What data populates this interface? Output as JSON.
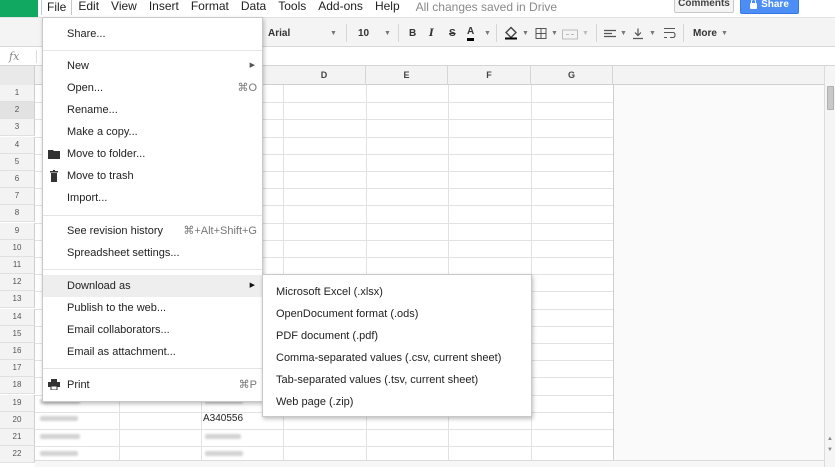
{
  "menubar": {
    "items": [
      "File",
      "Edit",
      "View",
      "Insert",
      "Format",
      "Data",
      "Tools",
      "Add-ons",
      "Help"
    ],
    "status": "All changes saved in Drive",
    "comments_label": "Comments",
    "share_label": "Share",
    "brand_color": "#11a861",
    "share_color": "#4c8ef6"
  },
  "toolbar": {
    "font_family": "Arial",
    "font_size": "10",
    "bold": "B",
    "italic": "I",
    "strike": "S",
    "text_color": "A",
    "more_label": "More"
  },
  "formula_bar": {
    "fx": "fx"
  },
  "columns": [
    "D",
    "E",
    "F",
    "G"
  ],
  "rows": [
    "1",
    "2",
    "3",
    "4",
    "5",
    "6",
    "7",
    "8",
    "9",
    "10",
    "11",
    "12",
    "13",
    "14",
    "15",
    "16",
    "17",
    "18",
    "19",
    "20",
    "21",
    "22"
  ],
  "selected_row": "2",
  "cells": {
    "visible_value": "A340556"
  },
  "file_menu": {
    "share": "Share...",
    "new": "New",
    "open": "Open...",
    "open_shortcut": "⌘O",
    "rename": "Rename...",
    "make_copy": "Make a copy...",
    "move_to_folder": "Move to folder...",
    "move_to_trash": "Move to trash",
    "import": "Import...",
    "revision_history": "See revision history",
    "revision_shortcut": "⌘+Alt+Shift+G",
    "spreadsheet_settings": "Spreadsheet settings...",
    "download_as": "Download as",
    "publish": "Publish to the web...",
    "email_collaborators": "Email collaborators...",
    "email_attachment": "Email as attachment...",
    "print": "Print",
    "print_shortcut": "⌘P"
  },
  "download_menu": {
    "items": [
      "Microsoft Excel (.xlsx)",
      "OpenDocument format (.ods)",
      "PDF document (.pdf)",
      "Comma-separated values (.csv, current sheet)",
      "Tab-separated values (.tsv, current sheet)",
      "Web page (.zip)"
    ]
  }
}
